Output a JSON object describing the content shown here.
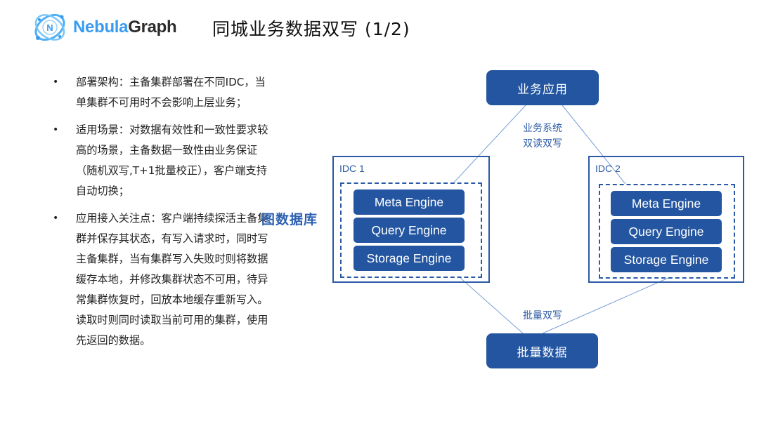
{
  "header": {
    "logo_icon": "nebula-orbit-logo-icon",
    "logo_brand_part1": "Nebula",
    "logo_brand_part2": "Graph",
    "title": "同城业务数据双写 (1/2)"
  },
  "bullets": [
    {
      "text": "部署架构：主备集群部署在不同IDC，当单集群不可用时不会影响上层业务；"
    },
    {
      "text": "适用场景：对数据有效性和一致性要求较高的场景，主备数据一致性由业务保证（随机双写,T+1批量校正），客户端支持自动切换；"
    },
    {
      "text": "应用接入关注点：客户端持续探活主备集群并保存其状态，有写入请求时，同时写主备集群，当有集群写入失败时则将数据缓存本地，并修改集群状态不可用，待异常集群恢复时，回放本地缓存重新写入。读取时则同时读取当前可用的集群，使用先返回的数据。"
    }
  ],
  "bullet_glyph": "•",
  "diagram": {
    "side_label": "图数据库",
    "top_node": "业务应用",
    "bottom_node": "批量数据",
    "top_edge_label_line1": "业务系统",
    "top_edge_label_line2": "双读双写",
    "bottom_edge_label": "批量双写",
    "idcs": [
      {
        "label": "IDC 1",
        "engines": [
          "Meta Engine",
          "Query Engine",
          "Storage Engine"
        ]
      },
      {
        "label": "IDC 2",
        "engines": [
          "Meta Engine",
          "Query Engine",
          "Storage Engine"
        ]
      }
    ]
  },
  "colors": {
    "node_fill": "#2355a0",
    "border": "#2a5aa5",
    "connector": "#7a9fd8",
    "brand_blue": "#3a9cf0",
    "brand_dark": "#2b2b2b"
  }
}
